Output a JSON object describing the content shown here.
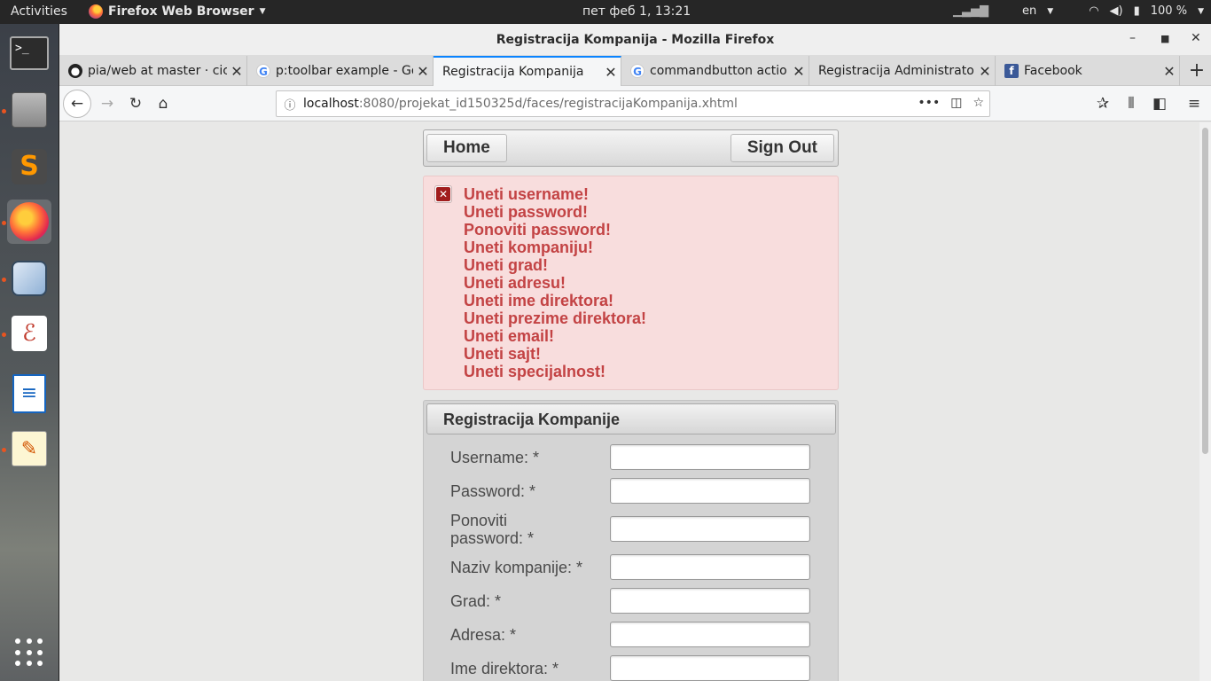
{
  "topbar": {
    "activities": "Activities",
    "app_name": "Firefox Web Browser",
    "clock": "пет феб  1, 13:21",
    "lang": "en",
    "battery": "100 %"
  },
  "window": {
    "title": "Registracija Kompanija - Mozilla Firefox"
  },
  "tabs": [
    {
      "title": "pia/web at master · cic",
      "icon": "github-icon"
    },
    {
      "title": "p:toolbar example - Go",
      "icon": "google-icon"
    },
    {
      "title": "Registracija Kompanija",
      "icon": "none"
    },
    {
      "title": "commandbutton actio",
      "icon": "google-icon"
    },
    {
      "title": "Registracija Administrato",
      "icon": "none"
    },
    {
      "title": "Facebook",
      "icon": "facebook-icon"
    }
  ],
  "url": {
    "host": "localhost",
    "rest": ":8080/projekat_id150325d/faces/registracijaKompanija.xhtml"
  },
  "menubar": {
    "home": "Home",
    "signout": "Sign Out"
  },
  "messages": [
    "Uneti username!",
    "Uneti password!",
    "Ponoviti password!",
    "Uneti kompaniju!",
    "Uneti grad!",
    "Uneti adresu!",
    "Uneti ime direktora!",
    "Uneti prezime direktora!",
    "Uneti email!",
    "Uneti sajt!",
    "Uneti specijalnost!"
  ],
  "form": {
    "header": "Registracija Kompanije",
    "fields": [
      {
        "label": "Username:  *",
        "value": ""
      },
      {
        "label": "Password:  *",
        "value": ""
      },
      {
        "label": "Ponoviti password:  *",
        "value": ""
      },
      {
        "label": "Naziv kompanije:  *",
        "value": ""
      },
      {
        "label": "Grad:  *",
        "value": ""
      },
      {
        "label": "Adresa:  *",
        "value": ""
      },
      {
        "label": "Ime direktora:  *",
        "value": ""
      }
    ]
  },
  "colors": {
    "accent": "#0a84ff",
    "error_text": "#c34344",
    "error_bg": "#f8dddd",
    "topbar": "#262626"
  }
}
